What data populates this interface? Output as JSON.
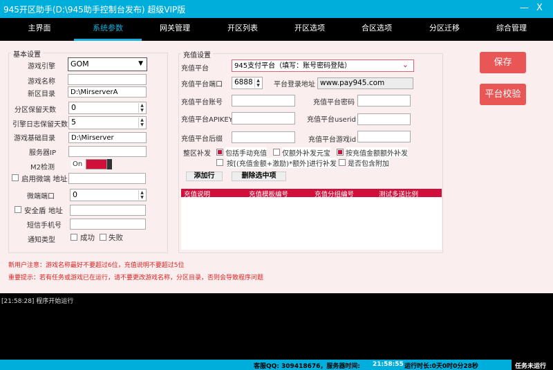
{
  "window": {
    "title": "945开区助手(D:\\945助手控制台发布) 超级VIP版",
    "minimize": "—",
    "close": "X"
  },
  "nav": {
    "tabs": [
      "主界面",
      "系统参数",
      "网关管理",
      "开区列表",
      "开区选项",
      "合区选项",
      "分区迁移",
      "综合管理"
    ],
    "active": 1
  },
  "basic": {
    "title": "基本设置",
    "engine_label": "游戏引擎",
    "engine_value": "GOM",
    "game_name_label": "游戏名称",
    "game_name_value": "",
    "new_dir_label": "新区目录",
    "new_dir_value": "D:\\MirserverA",
    "keep_days_label": "分区保留天数",
    "keep_days_value": "0",
    "log_days_label": "引擎日志保留天数",
    "log_days_value": "5",
    "base_dir_label": "游戏基础目录",
    "base_dir_value": "D:\\Mirserver",
    "server_ip_label": "服务器IP",
    "server_ip_value": "",
    "m2_label": "M2检测",
    "m2_state": "On",
    "microend_label": "启用微端 地址",
    "microend_checked": false,
    "microend_value": "",
    "microend_port_label": "微端端口",
    "microend_port_value": "0",
    "shield_label": "安全盾 地址",
    "shield_checked": false,
    "shield_value": "",
    "sms_label": "短信手机号",
    "sms_value": "",
    "notify_label": "通知类型",
    "notify_success": "成功",
    "notify_fail": "失败"
  },
  "recharge": {
    "title": "充值设置",
    "platform_label": "充值平台",
    "platform_value": "945支付平台（填写：账号密码登陆）",
    "port_label": "充值平台端口",
    "port_value": "6888",
    "login_url_label": "平台登录地址",
    "login_url_value": "www.pay945.com",
    "account_label": "充值平台账号",
    "password_label": "充值平台密码",
    "apikey_label": "充值平台APIKEY",
    "userid_label": "充值平台userid",
    "suffix_label": "充值平台后缀",
    "gameid_label": "充值平台游戏id",
    "reissue_label": "整区补发",
    "options": [
      {
        "label": "包括手动充值",
        "checked": true
      },
      {
        "label": "仅额外补发元宝",
        "checked": false
      },
      {
        "label": "按充值金额额外补发",
        "checked": true
      },
      {
        "label": "按[(充值金额+激励)*额外]进行补发",
        "checked": false
      },
      {
        "label": "是否包含附加",
        "checked": false
      }
    ],
    "add_row": "添加行",
    "delete_selected": "删除选中项",
    "columns": [
      "充值说明",
      "充值模板编号",
      "充值分组编号",
      "测试多送比例"
    ]
  },
  "actions": {
    "save": "保存",
    "verify": "平台校验"
  },
  "notes": [
    "新用户注意：游戏名称最好不要超过6位，充值说明不要超过5位",
    "重要提示：若有任务或游戏已在运行，请不要更改游戏名称，分区目录，否则会导致程序问题"
  ],
  "log": [
    "[21:58:28] 程序开始运行"
  ],
  "status": {
    "qq": "客服QQ: 309418676，服务器时间:",
    "time": "21:58:55",
    "runtime": "运行时长:0天0时0分28秒",
    "task": "任务未运行"
  },
  "colors": {
    "accent": "#00aedb",
    "danger": "#e85656",
    "header": "#d0103a"
  }
}
